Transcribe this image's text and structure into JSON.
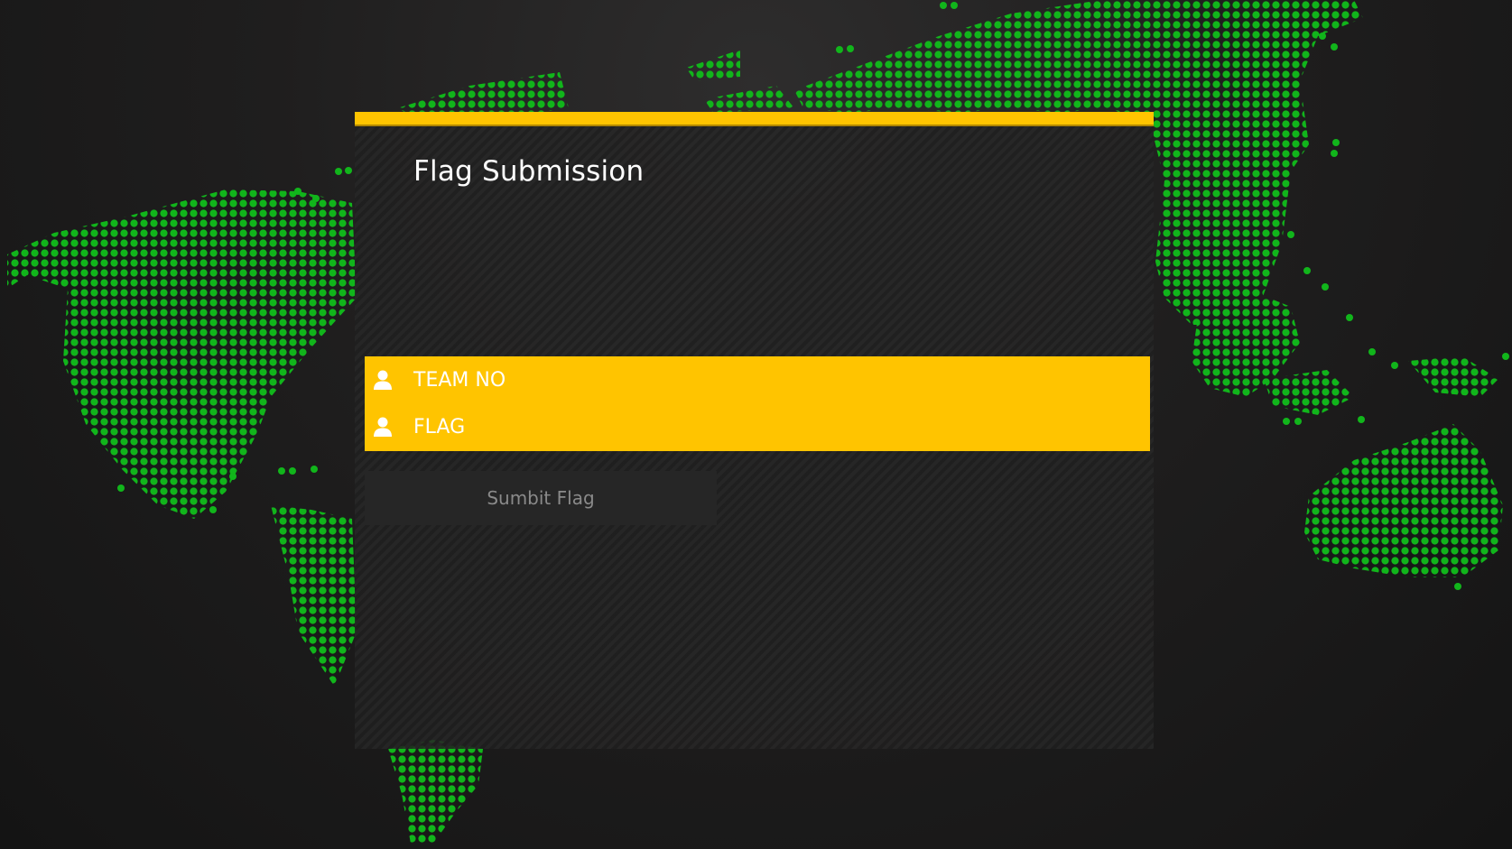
{
  "panel": {
    "title": "Flag Submission"
  },
  "form": {
    "team_field": {
      "placeholder": "TEAM NO",
      "icon": "user-icon",
      "value": ""
    },
    "flag_field": {
      "placeholder": "FLAG",
      "icon": "user-icon",
      "value": ""
    },
    "submit_label": "Sumbit Flag"
  },
  "colors": {
    "accent": "#ffc400",
    "map_dots": "#11b51b",
    "background": "#1c1c1c",
    "panel": "#222222",
    "button": "#262626",
    "button_text": "#8a8a8a"
  }
}
